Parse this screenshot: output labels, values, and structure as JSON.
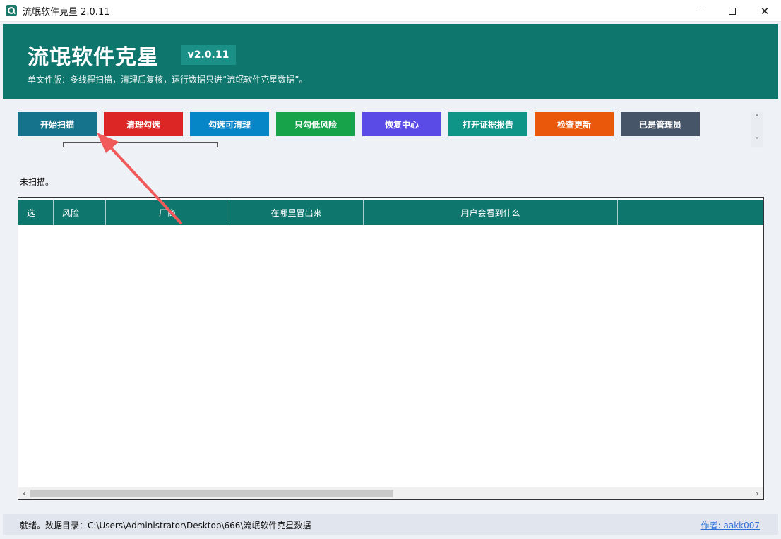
{
  "window": {
    "title": "流氓软件克星 2.0.11",
    "controls": [
      "minimize",
      "maximize",
      "close"
    ]
  },
  "header": {
    "app_name": "流氓软件克星",
    "version": "v2.0.11",
    "subtitle": "单文件版：多线程扫描，清理后复核，运行数据只进“流氓软件克星数据”。"
  },
  "toolbar": {
    "buttons": [
      {
        "label": "开始扫描",
        "color": "#15748b"
      },
      {
        "label": "清理勾选",
        "color": "#dc2626"
      },
      {
        "label": "勾选可清理",
        "color": "#0786c7"
      },
      {
        "label": "只勾低风险",
        "color": "#16a34a"
      },
      {
        "label": "恢复中心",
        "color": "#5b4be6"
      },
      {
        "label": "打开证据报告",
        "color": "#0f9488"
      },
      {
        "label": "检查更新",
        "color": "#ea580c"
      },
      {
        "label": "已是管理员",
        "color": "#475569"
      }
    ]
  },
  "scan_status": "未扫描。",
  "table": {
    "columns": [
      "选",
      "风险",
      "厂商",
      "在哪里冒出来",
      "用户会看到什么",
      ""
    ],
    "rows": []
  },
  "statusbar": {
    "message": "就绪。数据目录：C:\\Users\\Administrator\\Desktop\\666\\流氓软件克星数据",
    "author_link": "作者: aakk007"
  },
  "colors": {
    "header_bg": "#0f766e",
    "annotation_arrow": "#f05a5a"
  }
}
